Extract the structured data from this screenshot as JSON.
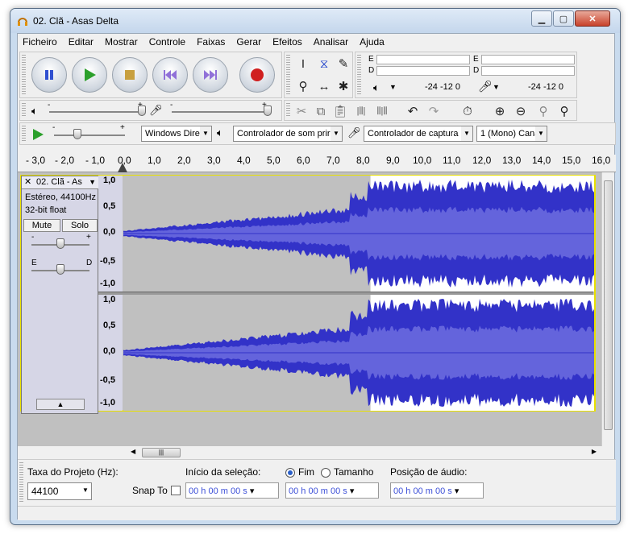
{
  "window": {
    "title": "02. Clã - Asas Delta"
  },
  "menu": [
    "Ficheiro",
    "Editar",
    "Mostrar",
    "Controle",
    "Faixas",
    "Gerar",
    "Efeitos",
    "Analisar",
    "Ajuda"
  ],
  "meters": {
    "out_left": "E",
    "out_right": "D",
    "in_left": "E",
    "in_right": "D",
    "scale1": "-24  -12  0",
    "scale2": "-24  -12  0"
  },
  "mixer": {
    "slider_min": "-",
    "slider_max": "+"
  },
  "device": {
    "host": "Windows Dire",
    "playback": "Controlador de som prir",
    "recording": "Controlador de captura",
    "channels": "1 (Mono) Cana"
  },
  "ruler": [
    "- 3,0",
    "- 2,0",
    "- 1,0",
    "0,0",
    "1,0",
    "2,0",
    "3,0",
    "4,0",
    "5,0",
    "6,0",
    "7,0",
    "8,0",
    "9,0",
    "10,0",
    "11,0",
    "12,0",
    "13,0",
    "14,0",
    "15,0",
    "16,0"
  ],
  "track": {
    "name": "02. Clã - As",
    "info1": "Estéreo, 44100Hz",
    "info2": "32-bit float",
    "mute": "Mute",
    "solo": "Solo",
    "gain_min": "-",
    "gain_max": "+",
    "pan_left": "E",
    "pan_right": "D",
    "scale": [
      "1,0",
      "0,5",
      "0,0",
      "-0,5",
      "-1,0"
    ],
    "selection_fraction": [
      0.525,
      1.0
    ]
  },
  "bottom": {
    "rate_label": "Taxa do Projeto (Hz):",
    "rate_value": "44100",
    "snap_label": "Snap To",
    "sel_start_label": "Início da seleção:",
    "end_label": "Fim",
    "length_label": "Tamanho",
    "audio_pos_label": "Posição de áudio:",
    "time1": "00 h 00 m 00 s",
    "time2": "00 h 00 m 00 s",
    "time3": "00 h 00 m 00 s"
  },
  "colors": {
    "wave": "#3232c8",
    "wave_rms": "#6464dc",
    "selection": "#5050e0",
    "bg": "#c0c0c0"
  }
}
